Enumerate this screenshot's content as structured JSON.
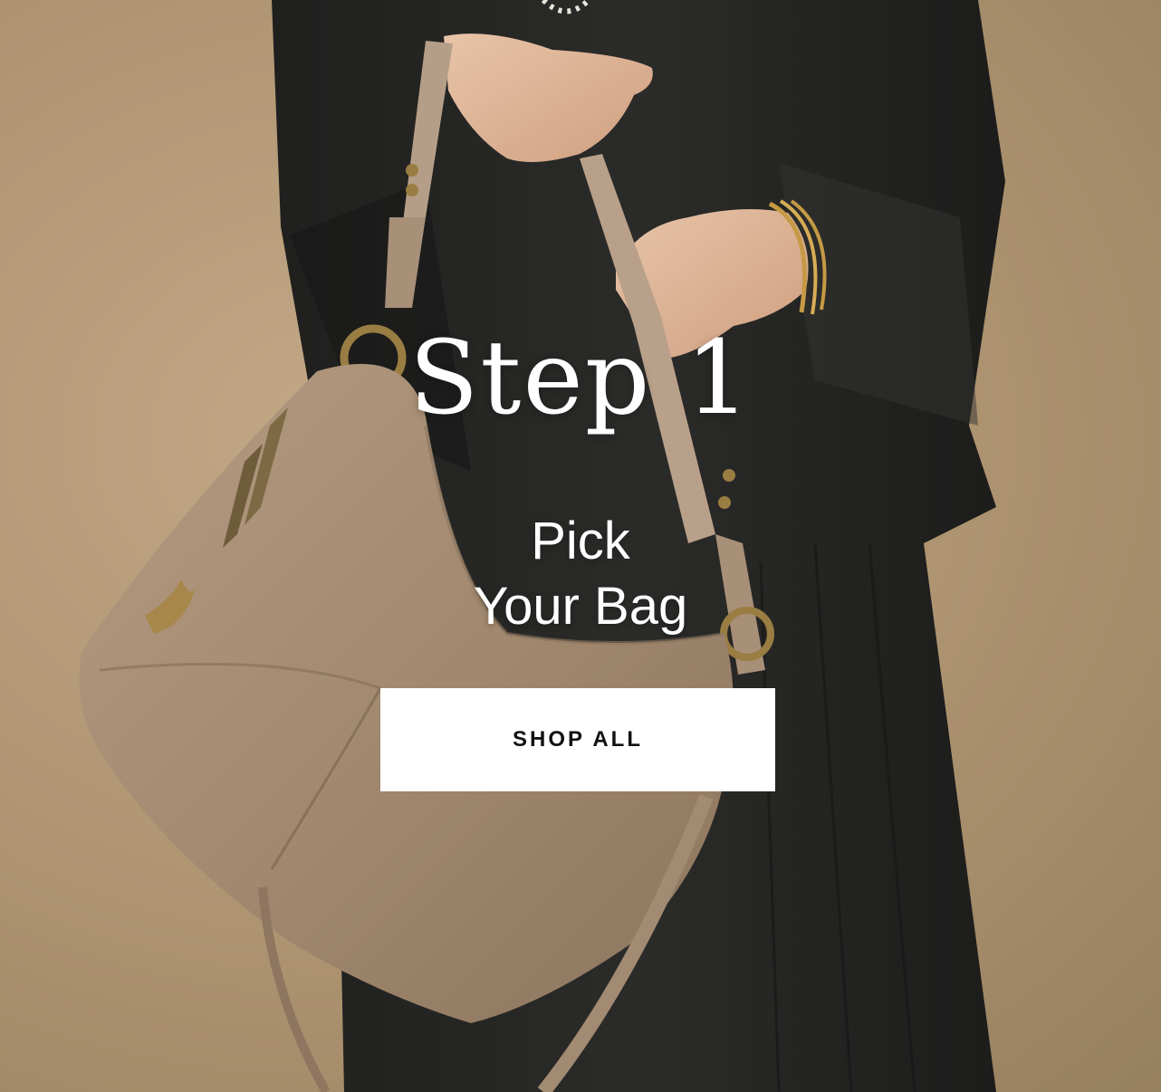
{
  "hero": {
    "image": "woman-holding-taupe-leather-shoulder-bag",
    "title": "Step 1",
    "subtitle_line1": "Pick",
    "subtitle_line2": "Your Bag",
    "cta_label": "SHOP ALL"
  },
  "colors": {
    "backdrop": "#b39a79",
    "suit": "#262625",
    "bag_leather": "#a58c73",
    "text": "#ffffff",
    "button_bg": "#ffffff",
    "button_text": "#111111"
  }
}
